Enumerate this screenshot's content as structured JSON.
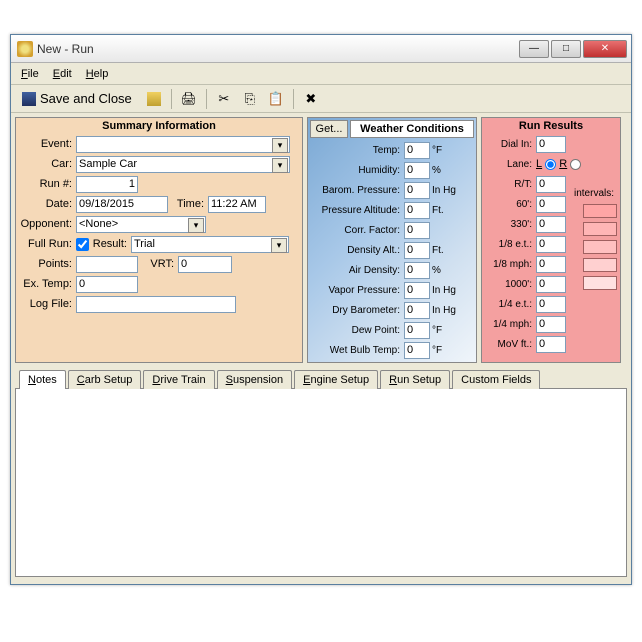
{
  "window": {
    "title": "New - Run"
  },
  "menu": {
    "file": "File",
    "edit": "Edit",
    "help": "Help"
  },
  "toolbar": {
    "save_close": "Save and Close"
  },
  "summary": {
    "title": "Summary Information",
    "event_lbl": "Event:",
    "event": "",
    "car_lbl": "Car:",
    "car": "Sample Car",
    "run_lbl": "Run #:",
    "run": "1",
    "date_lbl": "Date:",
    "date": "09/18/2015",
    "time_lbl": "Time:",
    "time": "11:22 AM",
    "opponent_lbl": "Opponent:",
    "opponent": "<None>",
    "fullrun_lbl": "Full Run:",
    "fullrun": true,
    "result_lbl": "Result:",
    "result": "Trial",
    "points_lbl": "Points:",
    "points": "",
    "vrt_lbl": "VRT:",
    "vrt": "0",
    "extemp_lbl": "Ex. Temp:",
    "extemp": "0",
    "logfile_lbl": "Log File:",
    "logfile": ""
  },
  "weather": {
    "get": "Get...",
    "title": "Weather Conditions",
    "temp_lbl": "Temp:",
    "temp": "0",
    "temp_u": "°F",
    "humidity_lbl": "Humidity:",
    "humidity": "0",
    "humidity_u": "%",
    "barom_lbl": "Barom. Pressure:",
    "barom": "0",
    "barom_u": "In Hg",
    "palt_lbl": "Pressure Altitude:",
    "palt": "0",
    "palt_u": "Ft.",
    "corr_lbl": "Corr. Factor:",
    "corr": "0",
    "corr_u": "",
    "dalt_lbl": "Density Alt.:",
    "dalt": "0",
    "dalt_u": "Ft.",
    "adens_lbl": "Air Density:",
    "adens": "0",
    "adens_u": "%",
    "vp_lbl": "Vapor Pressure:",
    "vp": "0",
    "vp_u": "In Hg",
    "dry_lbl": "Dry Barometer:",
    "dry": "0",
    "dry_u": "In Hg",
    "dew_lbl": "Dew Point:",
    "dew": "0",
    "dew_u": "°F",
    "wet_lbl": "Wet  Bulb Temp:",
    "wet": "0",
    "wet_u": "°F"
  },
  "results": {
    "title": "Run Results",
    "dialin_lbl": "Dial In:",
    "dialin": "0",
    "lane_lbl": "Lane:",
    "lane_l": "L",
    "lane_r": "R",
    "rt_lbl": "R/T:",
    "rt": "0",
    "sixty_lbl": "60':",
    "sixty": "0",
    "t330_lbl": "330':",
    "t330": "0",
    "eighth_et_lbl": "1/8 e.t.:",
    "eighth_et": "0",
    "eighth_mph_lbl": "1/8 mph:",
    "eighth_mph": "0",
    "t1000_lbl": "1000':",
    "t1000": "0",
    "quarter_et_lbl": "1/4 e.t.:",
    "quarter_et": "0",
    "quarter_mph_lbl": "1/4 mph:",
    "quarter_mph": "0",
    "mov_lbl": "MoV ft.:",
    "mov": "0",
    "intervals_lbl": "intervals:"
  },
  "tabs": {
    "notes": "Notes",
    "carb": "Carb Setup",
    "drive": "Drive Train",
    "susp": "Suspension",
    "engine": "Engine Setup",
    "run": "Run Setup",
    "custom": "Custom Fields"
  }
}
